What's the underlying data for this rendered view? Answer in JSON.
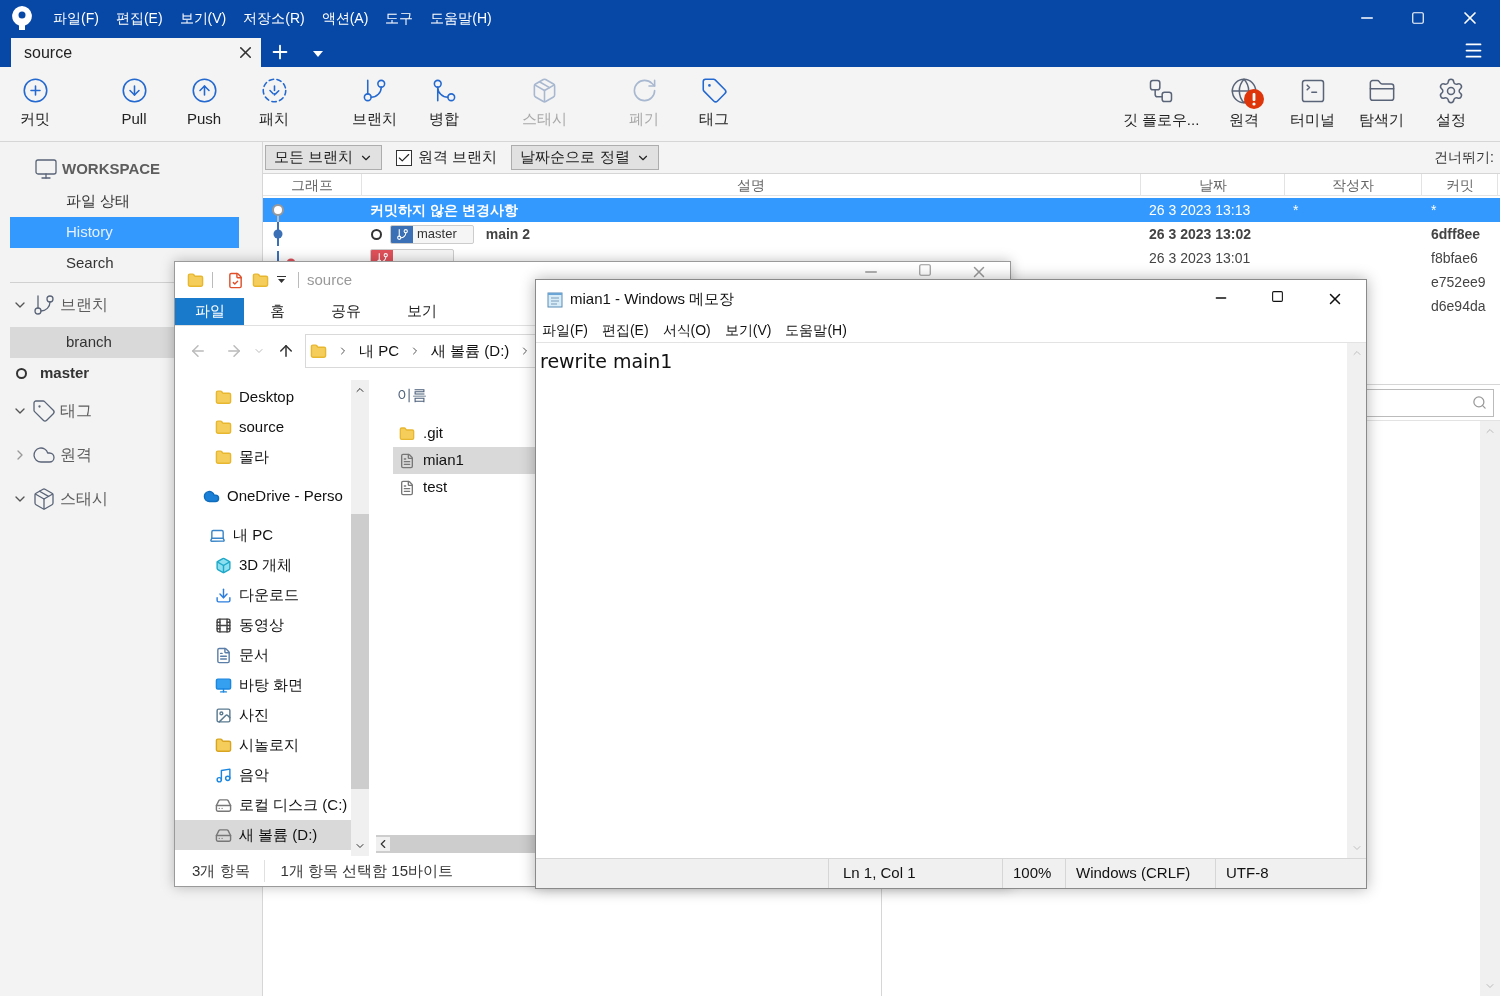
{
  "app": {
    "menu": [
      "파일(F)",
      "편집(E)",
      "보기(V)",
      "저장소(R)",
      "액션(A)",
      "도구",
      "도움말(H)"
    ],
    "tab": {
      "label": "source"
    },
    "toolbar_left": [
      {
        "label": "커밋",
        "disabled": false
      },
      {
        "label": "Pull",
        "disabled": false
      },
      {
        "label": "Push",
        "disabled": false
      },
      {
        "label": "패치",
        "disabled": false
      },
      {
        "label": "브랜치",
        "disabled": false
      },
      {
        "label": "병합",
        "disabled": false
      },
      {
        "label": "스태시",
        "disabled": true
      },
      {
        "label": "폐기",
        "disabled": true
      },
      {
        "label": "태그",
        "disabled": false
      }
    ],
    "toolbar_right": [
      {
        "label": "깃 플로우...",
        "alert": false
      },
      {
        "label": "원격",
        "alert": true
      },
      {
        "label": "터미널",
        "alert": false
      },
      {
        "label": "탐색기",
        "alert": false
      },
      {
        "label": "설정",
        "alert": false
      }
    ],
    "sidebar": {
      "sections": [
        {
          "label": "WORKSPACE",
          "kind": "workspace",
          "items": [
            {
              "label": "파일 상태",
              "selected": false,
              "current": false
            },
            {
              "label": "History",
              "selected": true,
              "current": false
            },
            {
              "label": "Search",
              "selected": false,
              "current": false
            }
          ]
        },
        {
          "label": "브랜치",
          "kind": "branches",
          "expanded": true,
          "items": [
            {
              "label": "branch",
              "selected": true,
              "current": false
            },
            {
              "label": "master",
              "selected": false,
              "current": true
            }
          ]
        },
        {
          "label": "태그",
          "kind": "tags",
          "expanded": true
        },
        {
          "label": "원격",
          "kind": "remotes",
          "expanded": false
        },
        {
          "label": "스태시",
          "kind": "stashes",
          "expanded": true
        }
      ]
    },
    "filters": {
      "branches": "모든 브랜치",
      "remote_branches": {
        "label": "원격 브랜치",
        "checked": true
      },
      "sort": "날짜순으로 정렬",
      "skip": "건너뛰기:"
    },
    "history": {
      "columns": [
        "그래프",
        "설명",
        "날짜",
        "작성자",
        "커밋"
      ],
      "rows": [
        {
          "kind": "uncommitted",
          "selected": true,
          "current": false,
          "description": "커밋하지 않은 변경사항",
          "date": "26 3 2023 13:13",
          "author": "*",
          "commit": "*"
        },
        {
          "kind": "commit",
          "selected": false,
          "current": true,
          "tag": {
            "label": "master",
            "color": "#3b6fb6"
          },
          "description": "main 2",
          "date": "26 3 2023 13:02",
          "commit": "6dff8ee"
        },
        {
          "kind": "commit",
          "selected": false,
          "current": false,
          "tag": {
            "color": "#e0505a"
          },
          "date": "26 3 2023 13:01",
          "commit": "f8bfae6"
        },
        {
          "kind": "commit",
          "selected": false,
          "current": false,
          "commit": "e752ee9"
        },
        {
          "kind": "commit",
          "selected": false,
          "current": false,
          "commit": "d6e94da"
        }
      ]
    }
  },
  "explorer": {
    "title": "source",
    "ribbon_tabs": [
      {
        "label": "파일",
        "selected": true
      },
      {
        "label": "홈",
        "selected": false
      },
      {
        "label": "공유",
        "selected": false
      },
      {
        "label": "보기",
        "selected": false
      }
    ],
    "path": [
      "내 PC",
      "새 볼륨 (D:)"
    ],
    "nav": [
      {
        "label": "Desktop",
        "kind": "folder",
        "selected": false
      },
      {
        "label": "source",
        "kind": "folder",
        "selected": false
      },
      {
        "label": "몰라",
        "kind": "folder",
        "selected": false
      },
      {
        "label": "OneDrive - Perso",
        "kind": "onedrive",
        "selected": false
      },
      {
        "label": "내 PC",
        "kind": "pc",
        "selected": false,
        "children": [
          {
            "label": "3D 개체",
            "kind": "cube",
            "selected": false
          },
          {
            "label": "다운로드",
            "kind": "download",
            "selected": false
          },
          {
            "label": "동영상",
            "kind": "film",
            "selected": false
          },
          {
            "label": "문서",
            "kind": "doc",
            "selected": false
          },
          {
            "label": "바탕 화면",
            "kind": "desktop",
            "selected": false
          },
          {
            "label": "사진",
            "kind": "photo",
            "selected": false
          },
          {
            "label": "시놀로지",
            "kind": "nas",
            "selected": false
          },
          {
            "label": "음악",
            "kind": "music",
            "selected": false
          },
          {
            "label": "로컬 디스크 (C:)",
            "kind": "drive",
            "selected": false
          },
          {
            "label": "새 볼륨 (D:)",
            "kind": "drive",
            "selected": true
          }
        ]
      }
    ],
    "column": "이름",
    "files": [
      {
        "name": ".git",
        "kind": "folder",
        "selected": false
      },
      {
        "name": "mian1",
        "kind": "file",
        "selected": true
      },
      {
        "name": "test",
        "kind": "file",
        "selected": false
      }
    ],
    "status": [
      "3개 항목",
      "1개 항목 선택함 15바이트"
    ]
  },
  "notepad": {
    "title": "mian1 - Windows 메모장",
    "menu": [
      "파일(F)",
      "편집(E)",
      "서식(O)",
      "보기(V)",
      "도움말(H)"
    ],
    "text": "rewrite main1",
    "status": [
      "Ln 1, Col 1",
      "100%",
      "Windows (CRLF)",
      "UTF-8"
    ]
  }
}
